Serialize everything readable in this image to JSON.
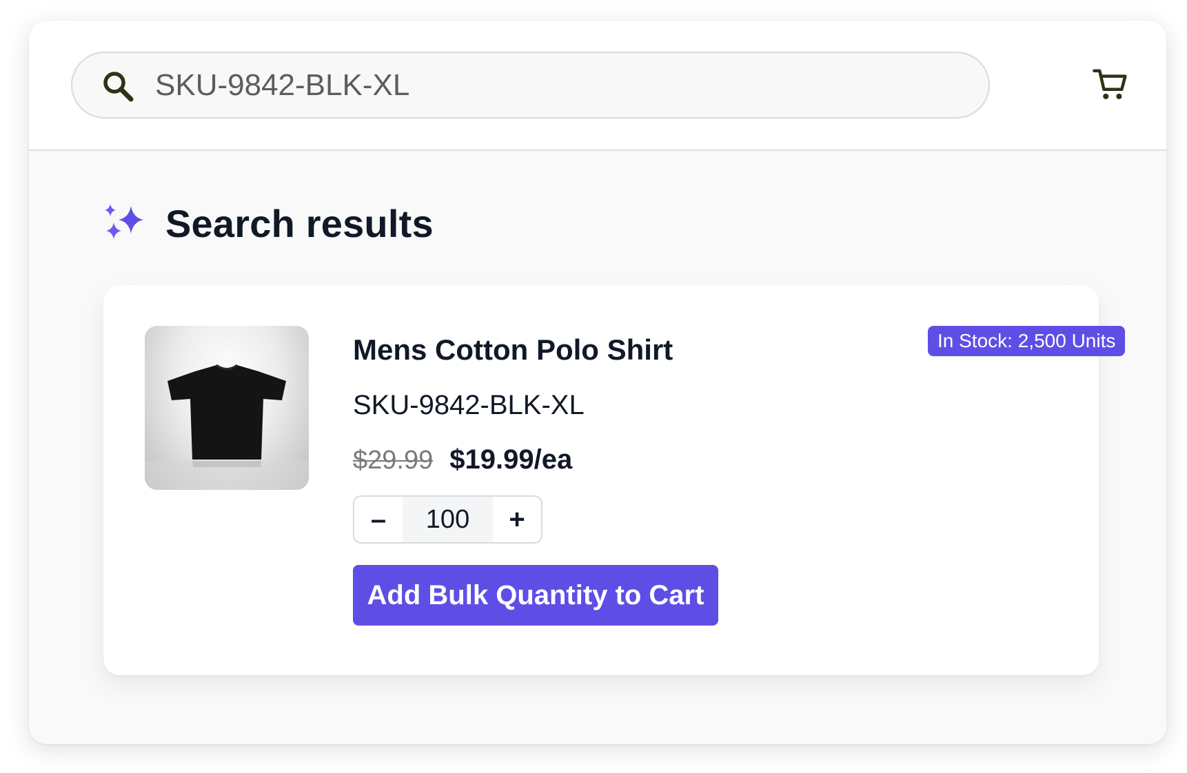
{
  "search": {
    "value": "SKU-9842-BLK-XL",
    "icon": "search-icon"
  },
  "cart": {
    "icon": "shopping-cart-icon"
  },
  "results": {
    "title": "Search results",
    "icon": "sparkles-icon",
    "accent_color": "#5f4ee6"
  },
  "product": {
    "name": "Mens Cotton Polo Shirt",
    "sku": "SKU-9842-BLK-XL",
    "stock_badge": "In Stock: 2,500 Units",
    "original_price": "$29.99",
    "price": "$19.99/ea",
    "quantity": "100",
    "decrement_label": "–",
    "increment_label": "+",
    "add_button_label": "Add Bulk Quantity to Cart",
    "image": "black-t-shirt-image"
  }
}
